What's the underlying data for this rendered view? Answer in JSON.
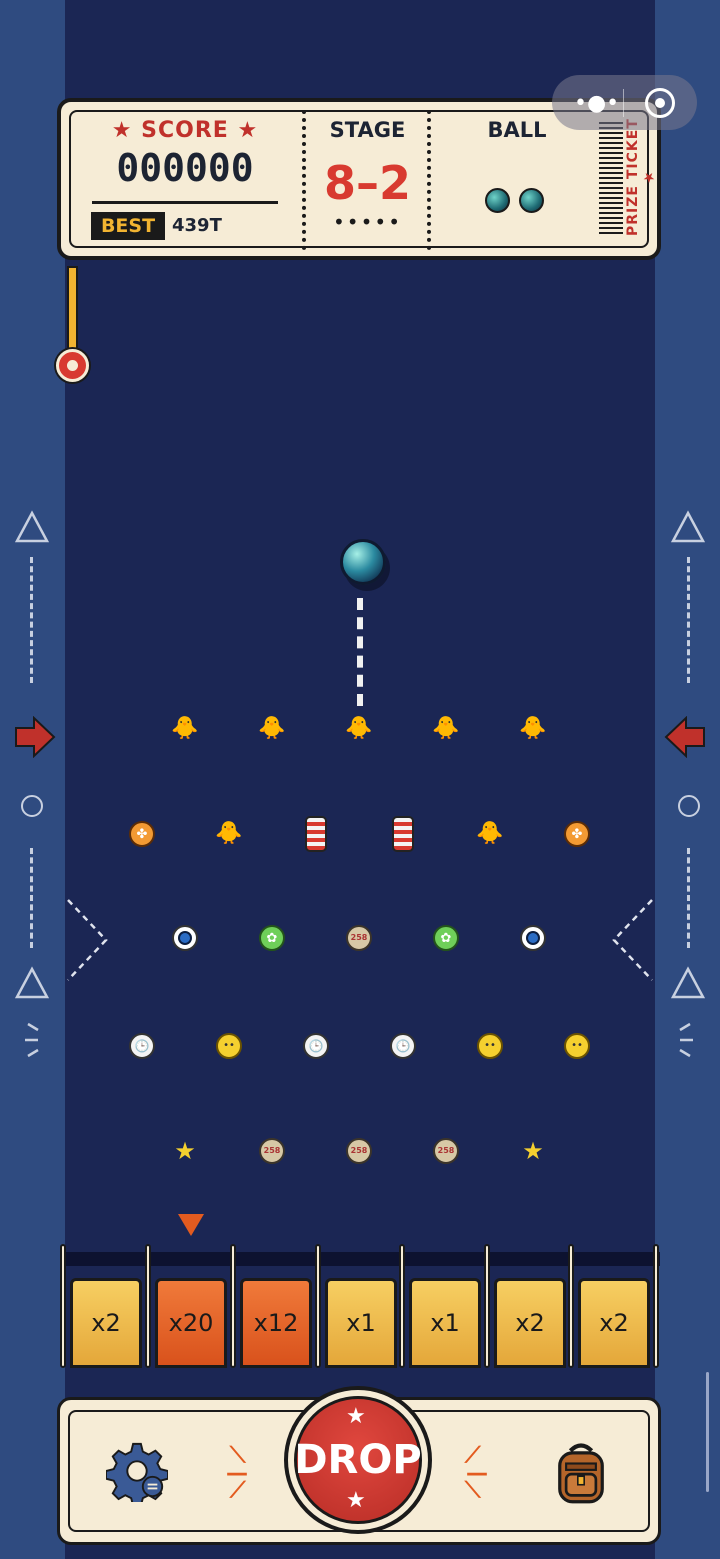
{
  "header": {
    "score_label": "★ SCORE ★",
    "score_value": "000000",
    "best_label": "BEST",
    "best_value": "439T",
    "stage_label": "STAGE",
    "stage_value": "8–2",
    "stage_dots": "•••••",
    "ball_label": "BALL",
    "balls_remaining": 2,
    "prize_label": "PRIZE TICKET ★"
  },
  "capsule": {
    "more_icon": "more-dots-icon",
    "close_icon": "target-close-icon"
  },
  "board": {
    "rows": [
      [
        "chick",
        "chick",
        "chick",
        "chick",
        "chick"
      ],
      [
        "wheel",
        "chick",
        "spring",
        "spring",
        "chick",
        "wheel"
      ],
      [
        "eye",
        "swirl",
        "coin",
        "swirl",
        "eye"
      ],
      [
        "clock",
        "smile",
        "clock",
        "clock",
        "smile",
        "smile"
      ],
      [
        "star",
        "coin",
        "coin",
        "coin",
        "star"
      ]
    ],
    "coin_text": "258"
  },
  "slots": [
    {
      "label": "x2",
      "color": "yellow"
    },
    {
      "label": "x20",
      "color": "orange"
    },
    {
      "label": "x12",
      "color": "orange"
    },
    {
      "label": "x1",
      "color": "yellow"
    },
    {
      "label": "x1",
      "color": "yellow"
    },
    {
      "label": "x2",
      "color": "yellow"
    },
    {
      "label": "x2",
      "color": "yellow"
    }
  ],
  "controls": {
    "drop_label": "DROP",
    "settings_icon": "gear-icon",
    "bag_icon": "backpack-icon"
  },
  "colors": {
    "accent_red": "#d83a30",
    "gold": "#f2b431",
    "board_bg": "#1b2654",
    "ticket_bg": "#f6ecd6"
  }
}
